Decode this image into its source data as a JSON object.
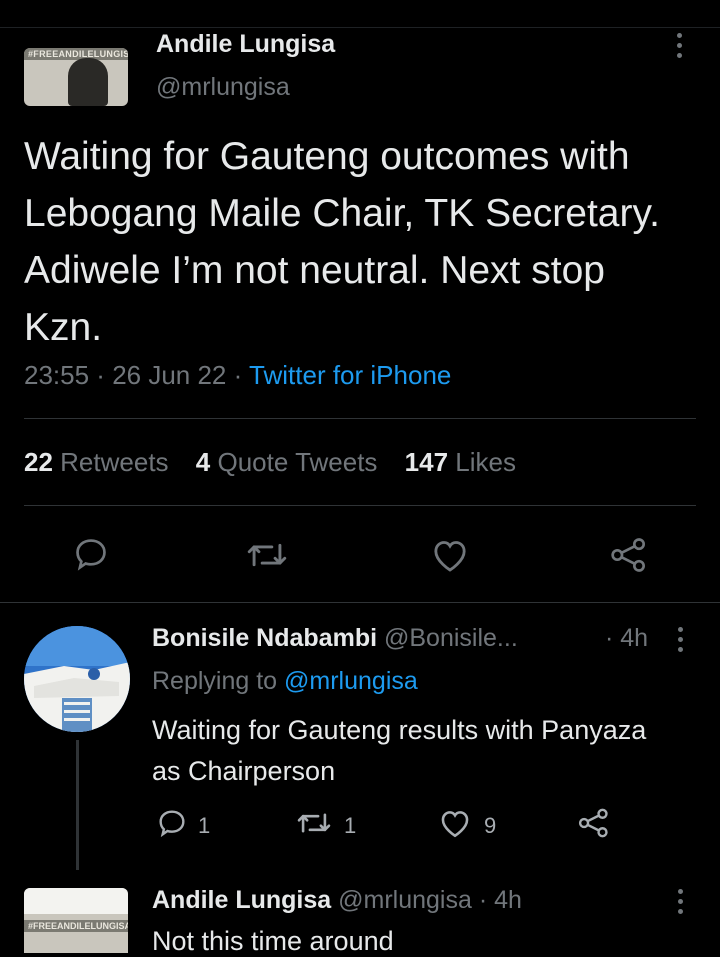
{
  "main_tweet": {
    "author_name": "Andile Lungisa",
    "author_handle": "@mrlungisa",
    "avatar_banner": "#FREEANDILELUNGISA",
    "text": "Waiting for Gauteng outcomes with Lebogang Maile Chair, TK Secretary. Adiwele I’m not neutral. Next stop Kzn.",
    "time": "23:55",
    "date": "26 Jun 22",
    "separator": " · ",
    "source": "Twitter for iPhone",
    "stats": {
      "retweets_count": "22",
      "retweets_label": "Retweets",
      "quotes_count": "4",
      "quotes_label": "Quote Tweets",
      "likes_count": "147",
      "likes_label": "Likes"
    }
  },
  "reply": {
    "author_name": "Bonisile Ndabambi",
    "author_handle": "@Bonisile...",
    "time": "· 4h",
    "replying_prefix": "Replying to",
    "replying_handle": "@mrlungisa",
    "text": "Waiting for Gauteng results with Panyaza as Chairperson",
    "reply_count": "1",
    "retweet_count": "1",
    "like_count": "9"
  },
  "next_reply": {
    "author_name": "Andile Lungisa",
    "author_handle": "@mrlungisa",
    "time": "· 4h",
    "text": "Not this time around",
    "avatar_banner": "#FREEANDILELUNGISA"
  },
  "colors": {
    "background": "#000000",
    "text": "#e7e9ea",
    "muted": "#71767b",
    "link": "#1d9bf0",
    "divider": "#2f3336"
  }
}
